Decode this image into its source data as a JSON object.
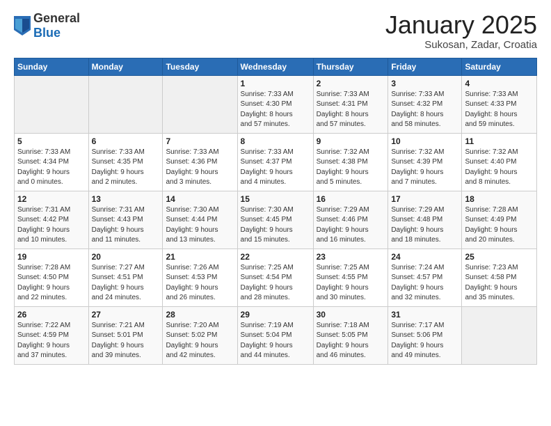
{
  "header": {
    "logo_general": "General",
    "logo_blue": "Blue",
    "title": "January 2025",
    "subtitle": "Sukosan, Zadar, Croatia"
  },
  "calendar": {
    "days_of_week": [
      "Sunday",
      "Monday",
      "Tuesday",
      "Wednesday",
      "Thursday",
      "Friday",
      "Saturday"
    ],
    "weeks": [
      [
        {
          "day": "",
          "info": ""
        },
        {
          "day": "",
          "info": ""
        },
        {
          "day": "",
          "info": ""
        },
        {
          "day": "1",
          "info": "Sunrise: 7:33 AM\nSunset: 4:30 PM\nDaylight: 8 hours\nand 57 minutes."
        },
        {
          "day": "2",
          "info": "Sunrise: 7:33 AM\nSunset: 4:31 PM\nDaylight: 8 hours\nand 57 minutes."
        },
        {
          "day": "3",
          "info": "Sunrise: 7:33 AM\nSunset: 4:32 PM\nDaylight: 8 hours\nand 58 minutes."
        },
        {
          "day": "4",
          "info": "Sunrise: 7:33 AM\nSunset: 4:33 PM\nDaylight: 8 hours\nand 59 minutes."
        }
      ],
      [
        {
          "day": "5",
          "info": "Sunrise: 7:33 AM\nSunset: 4:34 PM\nDaylight: 9 hours\nand 0 minutes."
        },
        {
          "day": "6",
          "info": "Sunrise: 7:33 AM\nSunset: 4:35 PM\nDaylight: 9 hours\nand 2 minutes."
        },
        {
          "day": "7",
          "info": "Sunrise: 7:33 AM\nSunset: 4:36 PM\nDaylight: 9 hours\nand 3 minutes."
        },
        {
          "day": "8",
          "info": "Sunrise: 7:33 AM\nSunset: 4:37 PM\nDaylight: 9 hours\nand 4 minutes."
        },
        {
          "day": "9",
          "info": "Sunrise: 7:32 AM\nSunset: 4:38 PM\nDaylight: 9 hours\nand 5 minutes."
        },
        {
          "day": "10",
          "info": "Sunrise: 7:32 AM\nSunset: 4:39 PM\nDaylight: 9 hours\nand 7 minutes."
        },
        {
          "day": "11",
          "info": "Sunrise: 7:32 AM\nSunset: 4:40 PM\nDaylight: 9 hours\nand 8 minutes."
        }
      ],
      [
        {
          "day": "12",
          "info": "Sunrise: 7:31 AM\nSunset: 4:42 PM\nDaylight: 9 hours\nand 10 minutes."
        },
        {
          "day": "13",
          "info": "Sunrise: 7:31 AM\nSunset: 4:43 PM\nDaylight: 9 hours\nand 11 minutes."
        },
        {
          "day": "14",
          "info": "Sunrise: 7:30 AM\nSunset: 4:44 PM\nDaylight: 9 hours\nand 13 minutes."
        },
        {
          "day": "15",
          "info": "Sunrise: 7:30 AM\nSunset: 4:45 PM\nDaylight: 9 hours\nand 15 minutes."
        },
        {
          "day": "16",
          "info": "Sunrise: 7:29 AM\nSunset: 4:46 PM\nDaylight: 9 hours\nand 16 minutes."
        },
        {
          "day": "17",
          "info": "Sunrise: 7:29 AM\nSunset: 4:48 PM\nDaylight: 9 hours\nand 18 minutes."
        },
        {
          "day": "18",
          "info": "Sunrise: 7:28 AM\nSunset: 4:49 PM\nDaylight: 9 hours\nand 20 minutes."
        }
      ],
      [
        {
          "day": "19",
          "info": "Sunrise: 7:28 AM\nSunset: 4:50 PM\nDaylight: 9 hours\nand 22 minutes."
        },
        {
          "day": "20",
          "info": "Sunrise: 7:27 AM\nSunset: 4:51 PM\nDaylight: 9 hours\nand 24 minutes."
        },
        {
          "day": "21",
          "info": "Sunrise: 7:26 AM\nSunset: 4:53 PM\nDaylight: 9 hours\nand 26 minutes."
        },
        {
          "day": "22",
          "info": "Sunrise: 7:25 AM\nSunset: 4:54 PM\nDaylight: 9 hours\nand 28 minutes."
        },
        {
          "day": "23",
          "info": "Sunrise: 7:25 AM\nSunset: 4:55 PM\nDaylight: 9 hours\nand 30 minutes."
        },
        {
          "day": "24",
          "info": "Sunrise: 7:24 AM\nSunset: 4:57 PM\nDaylight: 9 hours\nand 32 minutes."
        },
        {
          "day": "25",
          "info": "Sunrise: 7:23 AM\nSunset: 4:58 PM\nDaylight: 9 hours\nand 35 minutes."
        }
      ],
      [
        {
          "day": "26",
          "info": "Sunrise: 7:22 AM\nSunset: 4:59 PM\nDaylight: 9 hours\nand 37 minutes."
        },
        {
          "day": "27",
          "info": "Sunrise: 7:21 AM\nSunset: 5:01 PM\nDaylight: 9 hours\nand 39 minutes."
        },
        {
          "day": "28",
          "info": "Sunrise: 7:20 AM\nSunset: 5:02 PM\nDaylight: 9 hours\nand 42 minutes."
        },
        {
          "day": "29",
          "info": "Sunrise: 7:19 AM\nSunset: 5:04 PM\nDaylight: 9 hours\nand 44 minutes."
        },
        {
          "day": "30",
          "info": "Sunrise: 7:18 AM\nSunset: 5:05 PM\nDaylight: 9 hours\nand 46 minutes."
        },
        {
          "day": "31",
          "info": "Sunrise: 7:17 AM\nSunset: 5:06 PM\nDaylight: 9 hours\nand 49 minutes."
        },
        {
          "day": "",
          "info": ""
        }
      ]
    ]
  }
}
